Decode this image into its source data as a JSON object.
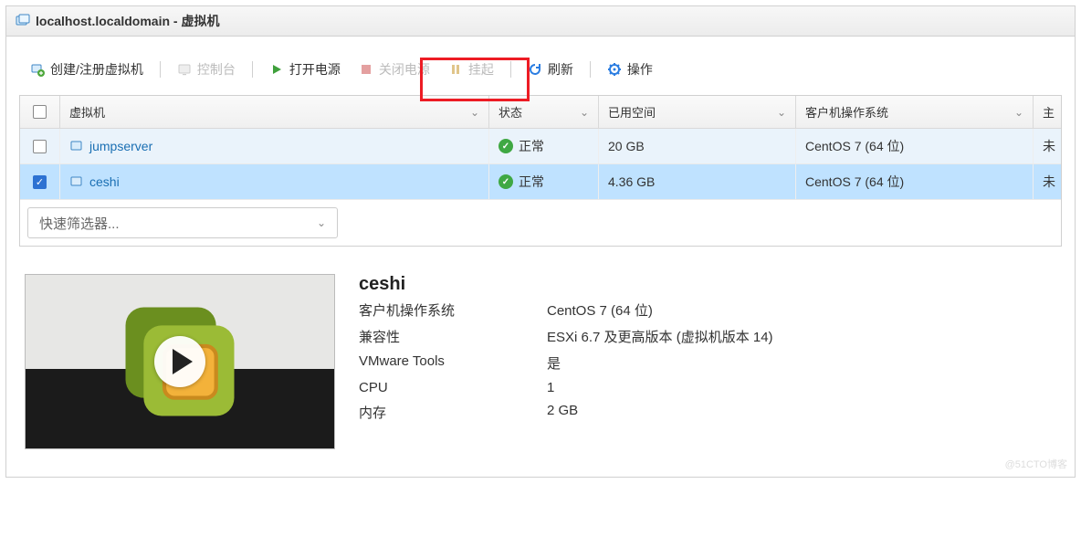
{
  "header": {
    "title": "localhost.localdomain - 虚拟机"
  },
  "toolbar": {
    "create": "创建/注册虚拟机",
    "console": "控制台",
    "power_on": "打开电源",
    "power_off": "关闭电源",
    "suspend": "挂起",
    "refresh": "刷新",
    "actions": "操作"
  },
  "table": {
    "headers": {
      "vm": "虚拟机",
      "status": "状态",
      "space": "已用空间",
      "os": "客户机操作系统",
      "host": "主"
    },
    "rows": [
      {
        "name": "jumpserver",
        "status": "正常",
        "space": "20 GB",
        "os": "CentOS 7 (64 位)",
        "host": "未",
        "checked": false
      },
      {
        "name": "ceshi",
        "status": "正常",
        "space": "4.36 GB",
        "os": "CentOS 7 (64 位)",
        "host": "未",
        "checked": true
      }
    ],
    "filter_placeholder": "快速筛选器..."
  },
  "detail": {
    "title": "ceshi",
    "rows": [
      {
        "label": "客户机操作系统",
        "value": "CentOS 7 (64 位)"
      },
      {
        "label": "兼容性",
        "value": "ESXi 6.7 及更高版本 (虚拟机版本 14)"
      },
      {
        "label": "VMware Tools",
        "value": "是"
      },
      {
        "label": "CPU",
        "value": "1"
      },
      {
        "label": "内存",
        "value": "2 GB"
      }
    ]
  },
  "watermark": "@51CTO博客"
}
